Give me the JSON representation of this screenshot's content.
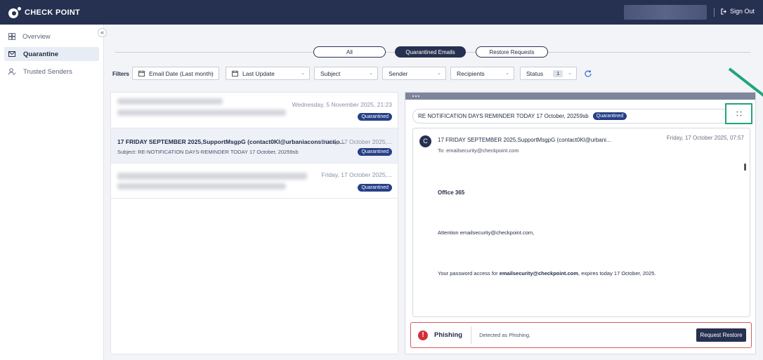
{
  "app": {
    "name": "CHECK POINT",
    "sign_out": "Sign Out"
  },
  "sidebar": {
    "collapse": "«",
    "items": [
      {
        "label": "Overview",
        "icon": "grid-icon",
        "active": false
      },
      {
        "label": "Quarantine",
        "icon": "mail-quarantine-icon",
        "active": true
      },
      {
        "label": "Trusted Senders",
        "icon": "user-check-icon",
        "active": false
      }
    ]
  },
  "tabs": [
    {
      "label": "All",
      "active": false
    },
    {
      "label": "Quarantined Emails",
      "active": true
    },
    {
      "label": "Restore Requests",
      "active": false
    }
  ],
  "filters": {
    "label": "Filters",
    "email_date": "Email Date (Last month)",
    "last_update": "Last Update",
    "subject": "Subject",
    "sender": "Sender",
    "recipients": "Recipients",
    "status": "Status",
    "status_count": "1"
  },
  "emails": [
    {
      "date": "Wednesday, 5 November 2025, 21:23",
      "status": "Quarantined"
    },
    {
      "from": "17 FRIDAY SEPTEMBER 2025,SupportMsgpG (contact0Kl@urbaniaconstructio...",
      "date": "Friday, 17 October 2025,...",
      "subject": "Subject: RE-NOTIFICATION DAYS-REMINDER TODAY 17 October, 20259sb",
      "status": "Quarantined"
    },
    {
      "date": "Friday, 17 October 2025,...",
      "status": "Quarantined"
    }
  ],
  "preview": {
    "subject": "RE NOTIFICATION DAYS REMINDER TODAY 17 October, 20259sb",
    "status": "Quarantined",
    "avatar": "C",
    "from": "17 FRIDAY SEPTEMBER 2025,SupportMsgpG (contact0Kl@urbani...",
    "date": "Friday, 17 October 2025, 07:57",
    "to": "To: emailsecurity@checkpoint.com",
    "body_heading": "Office 365",
    "body_attention": "Attention emailsecurity@checkpoint.com,",
    "body_line_pre": "Your password access for ",
    "body_line_bold": "emailsecurity@checkpoint.com",
    "body_line_post": ", expires today 17 October, 2025.",
    "verdict_title": "Phishing",
    "verdict_desc": "Detected as Phishing.",
    "restore_button": "Request Restore"
  },
  "colors": {
    "nav": "#263050",
    "accent": "#263f86",
    "highlight": "#23a47b",
    "danger": "#d32f3a"
  }
}
